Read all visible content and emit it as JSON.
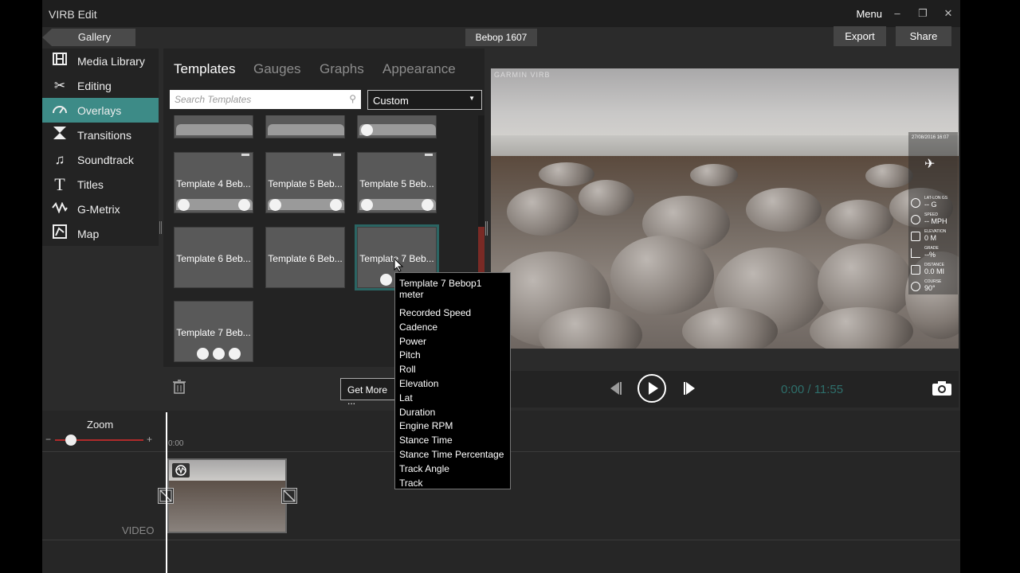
{
  "app": {
    "title": "VIRB Edit",
    "menu_label": "Menu"
  },
  "toolbar": {
    "gallery_label": "Gallery",
    "project_name": "Bebop 1607",
    "export_label": "Export",
    "share_label": "Share"
  },
  "nav": {
    "items": [
      {
        "label": "Media Library",
        "icon": "film-icon"
      },
      {
        "label": "Editing",
        "icon": "scissors-icon"
      },
      {
        "label": "Overlays",
        "icon": "gauge-icon",
        "active": true
      },
      {
        "label": "Transitions",
        "icon": "transition-icon"
      },
      {
        "label": "Soundtrack",
        "icon": "music-note-icon"
      },
      {
        "label": "Titles",
        "icon": "title-t-icon"
      },
      {
        "label": "G-Metrix",
        "icon": "g-metrix-icon"
      },
      {
        "label": "Map",
        "icon": "map-icon"
      }
    ]
  },
  "overlays": {
    "tabs": [
      "Templates",
      "Gauges",
      "Graphs",
      "Appearance"
    ],
    "active_tab": "Templates",
    "search_placeholder": "Search Templates",
    "filter_value": "Custom",
    "templates": [
      {
        "label": "Template 4 Beb..."
      },
      {
        "label": "Template 5 Beb..."
      },
      {
        "label": "Template 5 Beb..."
      },
      {
        "label": "Template 6 Beb..."
      },
      {
        "label": "Template 6 Beb..."
      },
      {
        "label": "Template 7 Beb...",
        "selected": true
      },
      {
        "label": "Template 7 Beb..."
      }
    ],
    "get_more_label": "Get More ..."
  },
  "tooltip": {
    "title": "Template 7 Bebop1 meter",
    "items": [
      "Recorded Speed",
      "Cadence",
      "Power",
      "Pitch",
      "Roll",
      "Elevation",
      "Lat",
      "Duration",
      "Engine RPM",
      "Stance Time",
      "Stance Time Percentage",
      "Track Angle",
      "Track"
    ]
  },
  "preview": {
    "watermark": "GARMIN VIRB",
    "hud": {
      "date": "27/08/2016 16:07",
      "rows": [
        {
          "label": "LAT-LON GS",
          "value": "-- G"
        },
        {
          "label": "SPEED",
          "value": "-- MPH"
        },
        {
          "label": "ELEVATION",
          "value": "0 M"
        },
        {
          "label": "GRADE",
          "value": "--%"
        },
        {
          "label": "DISTANCE",
          "value": "0.0 MI"
        },
        {
          "label": "COURSE",
          "value": "90°"
        }
      ]
    }
  },
  "transport": {
    "time": "0:00 / 11:55"
  },
  "timeline": {
    "zoom_label": "Zoom",
    "zoom_minus": "−",
    "zoom_plus": "+",
    "start_time": "0:00",
    "video_track_label": "VIDEO",
    "zoom_level": 0.18
  },
  "colors": {
    "accent": "#3d8b87",
    "time_text": "#2e6f6b",
    "scroll_accent": "#7a2a25"
  }
}
